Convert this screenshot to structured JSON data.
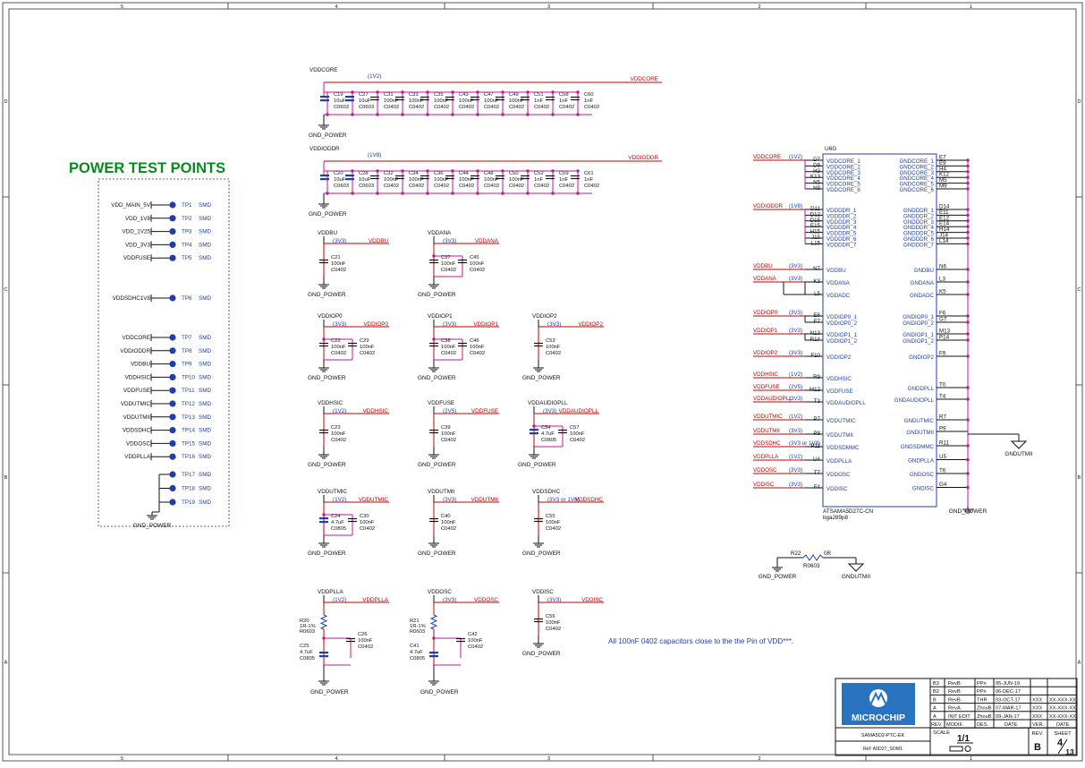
{
  "border": {
    "columns": [
      "5",
      "4",
      "3",
      "2",
      "1"
    ],
    "rows": [
      "D",
      "C",
      "B",
      "A"
    ]
  },
  "title": "POWER TEST POINTS",
  "test_points": {
    "group1": [
      {
        "net": "VDD_MAIN_5V",
        "tp": "TP1",
        "pkg": "SMD"
      },
      {
        "net": "VDD_1V8",
        "tp": "TP2",
        "pkg": "SMD"
      },
      {
        "net": "VDD_1V25",
        "tp": "TP3",
        "pkg": "SMD"
      },
      {
        "net": "VDD_3V3",
        "tp": "TP4",
        "pkg": "SMD"
      },
      {
        "net": "VDDFUSE",
        "tp": "TP5",
        "pkg": "SMD"
      }
    ],
    "group2": [
      {
        "net": "VDDSDHC1V8",
        "tp": "TP6",
        "pkg": "SMD"
      }
    ],
    "group3": [
      {
        "net": "VDDCORE",
        "tp": "TP7",
        "pkg": "SMD"
      },
      {
        "net": "VDDIODDR",
        "tp": "TP8",
        "pkg": "SMD"
      },
      {
        "net": "VDDBU",
        "tp": "TP9",
        "pkg": "SMD"
      },
      {
        "net": "VDDHSIC",
        "tp": "TP10",
        "pkg": "SMD"
      },
      {
        "net": "VDDFUSE",
        "tp": "TP11",
        "pkg": "SMD"
      },
      {
        "net": "VDDUTMIC",
        "tp": "TP12",
        "pkg": "SMD"
      },
      {
        "net": "VDDUTMII",
        "tp": "TP13",
        "pkg": "SMD"
      },
      {
        "net": "VDDSDHC",
        "tp": "TP14",
        "pkg": "SMD"
      },
      {
        "net": "VDDOSC",
        "tp": "TP15",
        "pkg": "SMD"
      },
      {
        "net": "VDDPLLA",
        "tp": "TP16",
        "pkg": "SMD"
      }
    ],
    "gnd_group": [
      {
        "tp": "TP17",
        "pkg": "SMD"
      },
      {
        "tp": "TP18",
        "pkg": "SMD"
      },
      {
        "tp": "TP19",
        "pkg": "SMD"
      }
    ],
    "gnd_label": "GND_POWER"
  },
  "bus_core": {
    "net": "VDDCORE",
    "voltage": "(1V2)",
    "gnd": "GND_POWER",
    "caps": [
      {
        "ref": "C19",
        "val": "10uF",
        "pkg": "C0603"
      },
      {
        "ref": "C27",
        "val": "10uF",
        "pkg": "C0603"
      },
      {
        "ref": "C31",
        "val": "100nF",
        "pkg": "C0402"
      },
      {
        "ref": "C33",
        "val": "100nF",
        "pkg": "C0402"
      },
      {
        "ref": "C35",
        "val": "100nF",
        "pkg": "C0402"
      },
      {
        "ref": "C43",
        "val": "100nF",
        "pkg": "C0402"
      },
      {
        "ref": "C47",
        "val": "100nF",
        "pkg": "C0402"
      },
      {
        "ref": "C49",
        "val": "100nF",
        "pkg": "C0402"
      },
      {
        "ref": "C51",
        "val": "1nF",
        "pkg": "C0402"
      },
      {
        "ref": "C58",
        "val": "1nF",
        "pkg": "C0402"
      },
      {
        "ref": "C60",
        "val": "1nF",
        "pkg": "C0402"
      }
    ]
  },
  "bus_ddr": {
    "net": "VDDIODDR",
    "voltage": "(1V8)",
    "gnd": "GND_POWER",
    "caps": [
      {
        "ref": "C20",
        "val": "10uF",
        "pkg": "C0603"
      },
      {
        "ref": "C28",
        "val": "10uF",
        "pkg": "C0603"
      },
      {
        "ref": "C32",
        "val": "100nF",
        "pkg": "C0402"
      },
      {
        "ref": "C34",
        "val": "100nF",
        "pkg": "C0402"
      },
      {
        "ref": "C36",
        "val": "100nF",
        "pkg": "C0402"
      },
      {
        "ref": "C44",
        "val": "100nF",
        "pkg": "C0402"
      },
      {
        "ref": "C48",
        "val": "100nF",
        "pkg": "C0402"
      },
      {
        "ref": "C50",
        "val": "100nF",
        "pkg": "C0402"
      },
      {
        "ref": "C52",
        "val": "1nF",
        "pkg": "C0402"
      },
      {
        "ref": "C59",
        "val": "1nF",
        "pkg": "C0402"
      },
      {
        "ref": "C61",
        "val": "1nF",
        "pkg": "C0402"
      }
    ]
  },
  "blocks": [
    {
      "title": "VDDBU",
      "voltage": "(3V3)",
      "net": "VDDBU",
      "gnd": "GND_POWER",
      "caps": [
        {
          "ref": "C21",
          "val": "100nF",
          "pkg": "C0402"
        }
      ]
    },
    {
      "title": "VDDANA",
      "voltage": "(3V3)",
      "net": "VDDANA",
      "gnd": "GND_POWER",
      "caps": [
        {
          "ref": "C37",
          "val": "100nF",
          "pkg": "C0402"
        },
        {
          "ref": "C45",
          "val": "100nF",
          "pkg": "C0402"
        }
      ]
    },
    {
      "title": "VDDIOP0",
      "voltage": "(3V3)",
      "net": "VDDIOP0",
      "gnd": "GND_POWER",
      "caps": [
        {
          "ref": "C22",
          "val": "100nF",
          "pkg": "C0402"
        },
        {
          "ref": "C29",
          "val": "100nF",
          "pkg": "C0402"
        }
      ]
    },
    {
      "title": "VDDIOP1",
      "voltage": "(3V3)",
      "net": "VDDIOP1",
      "gnd": "GND_POWER",
      "caps": [
        {
          "ref": "C38",
          "val": "100nF",
          "pkg": "C0402"
        },
        {
          "ref": "C46",
          "val": "100nF",
          "pkg": "C0402"
        }
      ]
    },
    {
      "title": "VDDIOP2",
      "voltage": "(3V3)",
      "net": "VDDIOP2",
      "gnd": "GND_POWER",
      "caps": [
        {
          "ref": "C53",
          "val": "100nF",
          "pkg": "C0402"
        }
      ]
    },
    {
      "title": "VDDHSIC",
      "voltage": "(1V2)",
      "net": "VDDHSIC",
      "gnd": "GND_POWER",
      "caps": [
        {
          "ref": "C23",
          "val": "100nF",
          "pkg": "C0402"
        }
      ]
    },
    {
      "title": "VDDFUSE",
      "voltage": "(2V5)",
      "net": "VDDFUSE",
      "gnd": "GND_POWER",
      "caps": [
        {
          "ref": "C39",
          "val": "100nF",
          "pkg": "C0402"
        }
      ]
    },
    {
      "title": "VDDAUDIOPLL",
      "voltage": "(3V3)",
      "net": "VDDAUDIOPLL",
      "gnd": "GND_POWER",
      "caps": [
        {
          "ref": "C54",
          "val": "4.7uF",
          "pkg": "C0805"
        },
        {
          "ref": "C57",
          "val": "100nF",
          "pkg": "C0402"
        }
      ]
    },
    {
      "title": "VDDUTMIC",
      "voltage": "(1V2)",
      "net": "VDDUTMIC",
      "gnd": "GND_POWER",
      "caps": [
        {
          "ref": "C24",
          "val": "4.7uF",
          "pkg": "C0805"
        },
        {
          "ref": "C30",
          "val": "100nF",
          "pkg": "C0402"
        }
      ]
    },
    {
      "title": "VDDUTMII",
      "voltage": "(3V3)",
      "net": "VDDUTMII",
      "gnd": "GND_POWER",
      "caps": [
        {
          "ref": "C40",
          "val": "100nF",
          "pkg": "C0402"
        }
      ]
    },
    {
      "title": "VDDSDHC",
      "voltage": "(3V3 or 1V8)",
      "net": "VDDSDHC",
      "gnd": "GND_POWER",
      "caps": [
        {
          "ref": "C55",
          "val": "100nF",
          "pkg": "C0402"
        }
      ]
    },
    {
      "title": "VDDPLLA",
      "voltage": "(1V2)",
      "net": "VDDPLLA",
      "gnd": "GND_POWER",
      "res": {
        "ref": "R20",
        "val": "1R-1%",
        "pkg": "R0603"
      },
      "caps": [
        {
          "ref": "C25",
          "val": "4.7uF",
          "pkg": "C0805"
        },
        {
          "ref": "C26",
          "val": "100nF",
          "pkg": "C0402"
        }
      ]
    },
    {
      "title": "VDDOSC",
      "voltage": "(3V3)",
      "net": "VDDOSC",
      "gnd": "GND_POWER",
      "res": {
        "ref": "R21",
        "val": "1R-1%",
        "pkg": "R0603"
      },
      "caps": [
        {
          "ref": "C41",
          "val": "4.7uF",
          "pkg": "C0805"
        },
        {
          "ref": "C42",
          "val": "100nF",
          "pkg": "C0402"
        }
      ]
    },
    {
      "title": "VDDISC",
      "voltage": "(3V3)",
      "net": "VDDISC",
      "gnd": "GND_POWER",
      "caps": [
        {
          "ref": "C56",
          "val": "100nF",
          "pkg": "C0402"
        }
      ]
    }
  ],
  "ic": {
    "ref": "U6G",
    "part": "ATSAMA5D27C-CN",
    "footprint": "bga289p8",
    "left_groups": [
      {
        "net": "VDDCORE",
        "voltage": "(1V2)",
        "pins": [
          {
            "ball": "D7",
            "name": "VDDCORE_1"
          },
          {
            "ball": "D9",
            "name": "VDDCORE_2"
          },
          {
            "ball": "H3",
            "name": "VDDCORE_3"
          },
          {
            "ball": "K13",
            "name": "VDDCORE_4"
          },
          {
            "ball": "N5",
            "name": "VDDCORE_5"
          },
          {
            "ball": "N9",
            "name": "VDDCORE_6"
          }
        ]
      },
      {
        "net": "VDDIODDR",
        "voltage": "(1V8)",
        "pins": [
          {
            "ball": "D11",
            "name": "VDDDDR_1"
          },
          {
            "ball": "D12",
            "name": "VDDDDR_2"
          },
          {
            "ball": "D15",
            "name": "VDDDDR_3"
          },
          {
            "ball": "E15",
            "name": "VDDDDR_4"
          },
          {
            "ball": "H15",
            "name": "VDDDDR_5"
          },
          {
            "ball": "J15",
            "name": "VDDDDR_6"
          },
          {
            "ball": "L15",
            "name": "VDDDDR_7"
          }
        ]
      },
      {
        "net": "VDDBU",
        "voltage": "(3V3)",
        "pins": [
          {
            "ball": "N7",
            "name": "VDDBU"
          }
        ]
      },
      {
        "net": "VDDANA",
        "voltage": "(3V3)",
        "pins": [
          {
            "ball": "K3",
            "name": "VDDANA"
          },
          {
            "ball": "L5",
            "name": "VDDADC"
          }
        ]
      },
      {
        "net": "VDDIOP0",
        "voltage": "(3V3)",
        "pins": [
          {
            "ball": "E6",
            "name": "VDDIOP0_1"
          },
          {
            "ball": "F7",
            "name": "VDDIOP0_2"
          }
        ]
      },
      {
        "net": "VDDIOP1",
        "voltage": "(3V3)",
        "pins": [
          {
            "ball": "N13",
            "name": "VDDIOP1_1"
          },
          {
            "ball": "R14",
            "name": "VDDIOP1_2"
          }
        ]
      },
      {
        "net": "VDDIOP2",
        "voltage": "(3V3)",
        "pins": [
          {
            "ball": "F10",
            "name": "VDDIOP2"
          }
        ]
      },
      {
        "net": "VDDHSIC",
        "voltage": "(1V2)",
        "pins": [
          {
            "ball": "R9",
            "name": "VDDHSIC"
          }
        ]
      },
      {
        "net": "VDDFUSE",
        "voltage": "(2V5)",
        "pins": [
          {
            "ball": "M12",
            "name": "VDDFUSE"
          }
        ]
      },
      {
        "net": "VDDAUDIOPLL",
        "voltage": "(3V3)",
        "pins": [
          {
            "ball": "T3",
            "name": "VDDAUDIOPLL"
          }
        ]
      },
      {
        "net": "VDDUTMIC",
        "voltage": "(1V2)",
        "pins": [
          {
            "ball": "P7",
            "name": "VDDUTMIC"
          }
        ]
      },
      {
        "net": "VDDUTMII",
        "voltage": "(3V3)",
        "pins": [
          {
            "ball": "P8",
            "name": "VDDUTMII"
          }
        ]
      },
      {
        "net": "VDDSDHC",
        "voltage": "(3V3 or 1V8)",
        "pins": [
          {
            "ball": "P11",
            "name": "VDDSDMMC"
          }
        ]
      },
      {
        "net": "VDDPLLA",
        "voltage": "(1V2)",
        "pins": [
          {
            "ball": "U4",
            "name": "VDDPLLA"
          }
        ]
      },
      {
        "net": "VDDOSC",
        "voltage": "(3V3)",
        "pins": [
          {
            "ball": "T7",
            "name": "VDDOSC"
          }
        ]
      },
      {
        "net": "VDDISC",
        "voltage": "(3V3)",
        "pins": [
          {
            "ball": "F4",
            "name": "VDDISC"
          }
        ]
      }
    ],
    "right_groups": [
      {
        "pins": [
          {
            "ball": "E7",
            "name": "GNDCORE_1"
          },
          {
            "ball": "E9",
            "name": "GNDCORE_2"
          },
          {
            "ball": "H4",
            "name": "GNDCORE_3"
          },
          {
            "ball": "K12",
            "name": "GNDCORE_4"
          },
          {
            "ball": "M5",
            "name": "GNDCORE_5"
          },
          {
            "ball": "M9",
            "name": "GNDCORE_6"
          }
        ]
      },
      {
        "pins": [
          {
            "ball": "D14",
            "name": "GNDDDR_1"
          },
          {
            "ball": "E11",
            "name": "GNDDDR_2"
          },
          {
            "ball": "E12",
            "name": "GNDDDR_3"
          },
          {
            "ball": "E14",
            "name": "GNDDDR_4"
          },
          {
            "ball": "H14",
            "name": "GNDDDR_5"
          },
          {
            "ball": "J14",
            "name": "GNDDDR_6"
          },
          {
            "ball": "L14",
            "name": "GNDDDR_7"
          }
        ]
      },
      {
        "pins": [
          {
            "ball": "N6",
            "name": "GNDBU"
          }
        ]
      },
      {
        "pins": [
          {
            "ball": "L3",
            "name": "GNDANA"
          },
          {
            "ball": "K5",
            "name": "GNDADC"
          }
        ]
      },
      {
        "pins": [
          {
            "ball": "F6",
            "name": "GNDIOP0_1"
          },
          {
            "ball": "G7",
            "name": "GNDIOP0_2"
          }
        ]
      },
      {
        "pins": [
          {
            "ball": "M13",
            "name": "GNDIOP1_1"
          },
          {
            "ball": "P14",
            "name": "GNDIOP1_2"
          }
        ]
      },
      {
        "pins": [
          {
            "ball": "F9",
            "name": "GNDIOP2"
          }
        ]
      },
      {
        "pins": [
          {
            "ball": "T0",
            "name": "GNDDPLL"
          },
          {
            "ball": "T4",
            "name": "GNDAUDIOPLL"
          }
        ]
      },
      {
        "pins": [
          {
            "ball": "R7",
            "name": "GNDUTMIC"
          },
          {
            "ball": "P9",
            "name": "GNDUTMII"
          }
        ]
      },
      {
        "pins": [
          {
            "ball": "R11",
            "name": "GNDSDMMC"
          },
          {
            "ball": "U5",
            "name": "GNDPLLA"
          },
          {
            "ball": "T6",
            "name": "GNDOSC"
          },
          {
            "ball": "G4",
            "name": "GNDISC"
          }
        ]
      }
    ],
    "gnd": "GND_POWER",
    "gndutmii": "GNDUTMII"
  },
  "r22": {
    "ref": "R22",
    "val": "0R",
    "pkg": "R0603",
    "left": "GND_POWER",
    "right": "GNDUTMII"
  },
  "note": "All 100nF 0402 capacitors close to the the Pin of VDD***.",
  "title_block": {
    "logo": "MICROCHIP",
    "revisions": [
      {
        "rev": "B3",
        "modif": "RevB",
        "des": "PPn",
        "date": "05-JUN-19"
      },
      {
        "rev": "B2",
        "modif": "RevB",
        "des": "PPn",
        "date": "06-DEC-17"
      },
      {
        "rev": "B",
        "modif": "RevB",
        "des": "THR",
        "date": "03-OCT-17",
        "ver": "XXX",
        "dte": "XX-XXX-XX"
      },
      {
        "rev": "A",
        "modif": "RevA",
        "des": "ZhouB",
        "date": "07-MAR-17",
        "ver": "XXX",
        "dte": "XX-XXX-XX"
      },
      {
        "rev": "A",
        "modif": "INIT EDIT",
        "des": "ZhouB",
        "date": "09-JAN-17",
        "ver": "XXX",
        "dte": "XX-XXX-XX"
      }
    ],
    "headers": {
      "rev": "REV.",
      "modif": "MODIF.",
      "des": "DES.",
      "date": "DATE",
      "ver": "VER.",
      "dte": "DATE"
    },
    "board": "SAMA5D2-PTC-EK",
    "doc": "Ref: A5D27_SOM1",
    "scale_label": "SCALE",
    "scale": "1/1",
    "rev_label": "REV.",
    "rev": "B",
    "sheet_label": "SHEET",
    "sheet_num": "4",
    "sheet_total": "13"
  }
}
